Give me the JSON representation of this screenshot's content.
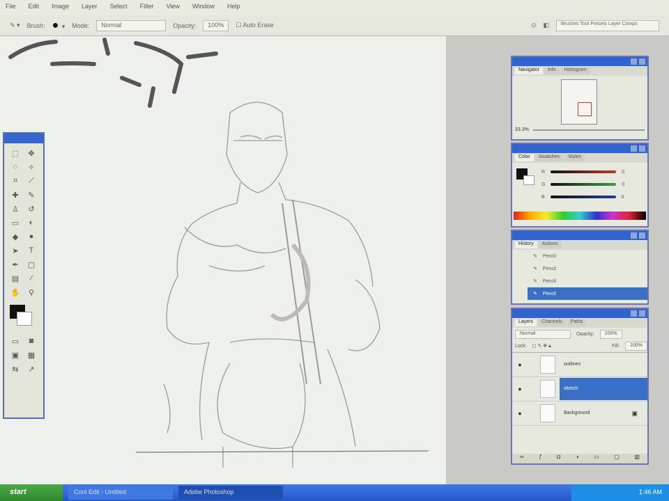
{
  "menu": [
    "File",
    "Edit",
    "Image",
    "Layer",
    "Select",
    "Filter",
    "View",
    "Window",
    "Help"
  ],
  "options": {
    "brush_label": "Brush:",
    "mode_label": "Mode:",
    "mode_value": "Normal",
    "opacity_label": "Opacity:",
    "opacity_value": "100%",
    "airbrush_label": "Auto Erase",
    "palette_well": "Brushes  Tool Presets  Layer Comps"
  },
  "navigator": {
    "tabs": [
      "Navigator",
      "Info",
      "Histogram"
    ],
    "zoom": "33.3%"
  },
  "color": {
    "tabs": [
      "Color",
      "Swatches",
      "Styles"
    ],
    "channels": [
      {
        "label": "R",
        "value": "0",
        "color": "#c0392b"
      },
      {
        "label": "G",
        "value": "0",
        "color": "#3aa04a"
      },
      {
        "label": "B",
        "value": "0",
        "color": "#2a3a9a"
      }
    ]
  },
  "history": {
    "tabs": [
      "History",
      "Actions"
    ],
    "items": [
      "Pencil",
      "Pencil",
      "Pencil",
      "Pencil"
    ]
  },
  "layers": {
    "tabs": [
      "Layers",
      "Channels",
      "Paths"
    ],
    "blend": "Normal",
    "opacity_label": "Opacity:",
    "opacity": "100%",
    "lock_label": "Lock:",
    "fill_label": "Fill:",
    "fill": "100%",
    "items": [
      {
        "name": "outlines",
        "selected": false
      },
      {
        "name": "sketch",
        "selected": true
      },
      {
        "name": "Background",
        "selected": false
      }
    ]
  },
  "taskbar": {
    "start": "start",
    "tasks": [
      "Cool Edit - Untitled",
      "Adobe Photoshop"
    ],
    "clock": "1:46 AM"
  }
}
